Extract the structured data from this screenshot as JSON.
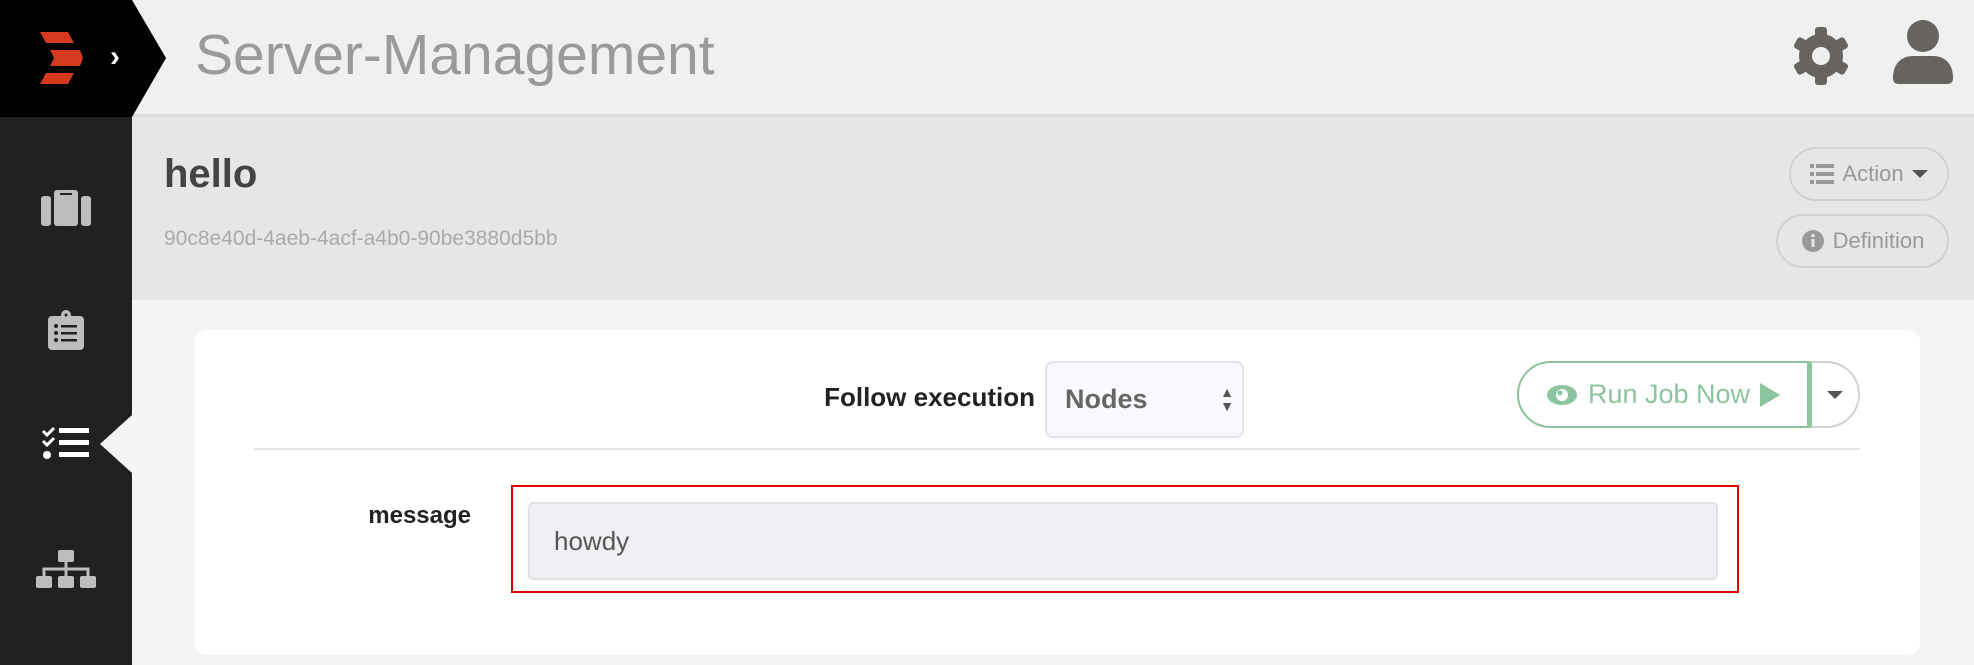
{
  "app": {
    "title": "Server-Management",
    "brand_color": "#d63a1e"
  },
  "sidebar": {
    "items": [
      {
        "name": "projects",
        "icon": "suitcase-icon"
      },
      {
        "name": "activity",
        "icon": "clipboard-list-icon"
      },
      {
        "name": "jobs",
        "icon": "tasks-icon",
        "active": true
      },
      {
        "name": "nodes",
        "icon": "sitemap-icon"
      }
    ]
  },
  "header": {
    "job_name": "hello",
    "job_uuid": "90c8e40d-4aeb-4acf-a4b0-90be3880d5bb",
    "action_label": "Action",
    "definition_label": "Definition"
  },
  "run": {
    "follow_label": "Follow execution",
    "follow_selected": "Nodes",
    "run_label": "Run Job Now",
    "accent": "#8cc4a0"
  },
  "options": [
    {
      "label": "message",
      "value": "howdy"
    }
  ]
}
